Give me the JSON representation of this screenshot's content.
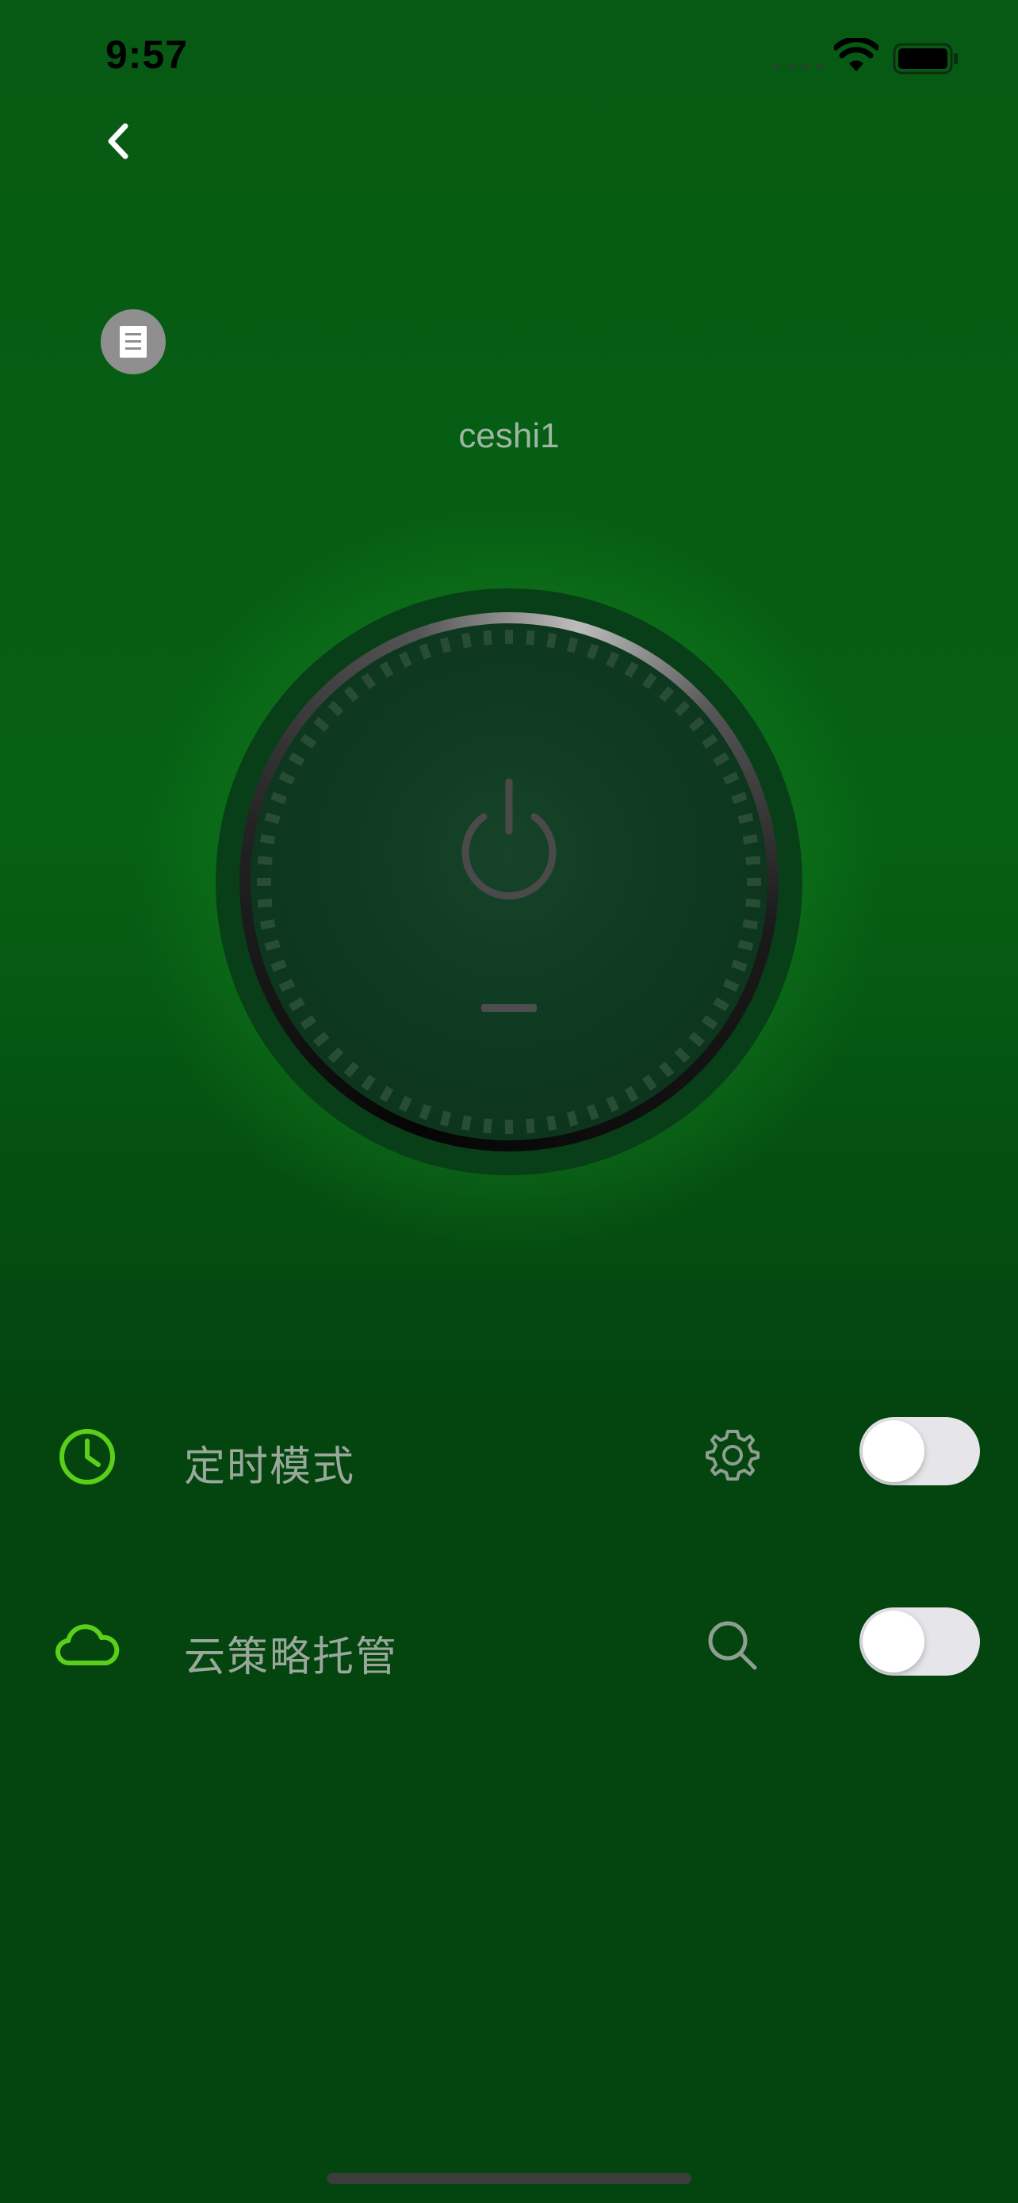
{
  "status_bar": {
    "time": "9:57",
    "wifi_icon": "wifi-icon",
    "battery_icon": "battery-icon",
    "signal_icon": "signal-icon"
  },
  "nav": {
    "back_icon": "chevron-left-icon",
    "info_icon": "document-icon"
  },
  "device": {
    "name": "ceshi1",
    "power_icon": "power-icon",
    "power_on": false
  },
  "settings": [
    {
      "icon": "clock-icon",
      "label": "定时模式",
      "action_icon": "gear-icon",
      "enabled": false
    },
    {
      "icon": "cloud-icon",
      "label": "云策略托管",
      "action_icon": "search-icon",
      "enabled": false
    }
  ],
  "colors": {
    "background": "#04450f",
    "accent_green": "#5ad01a",
    "label_gray": "#9aa89c",
    "toggle_off": "#e6e6ea"
  }
}
